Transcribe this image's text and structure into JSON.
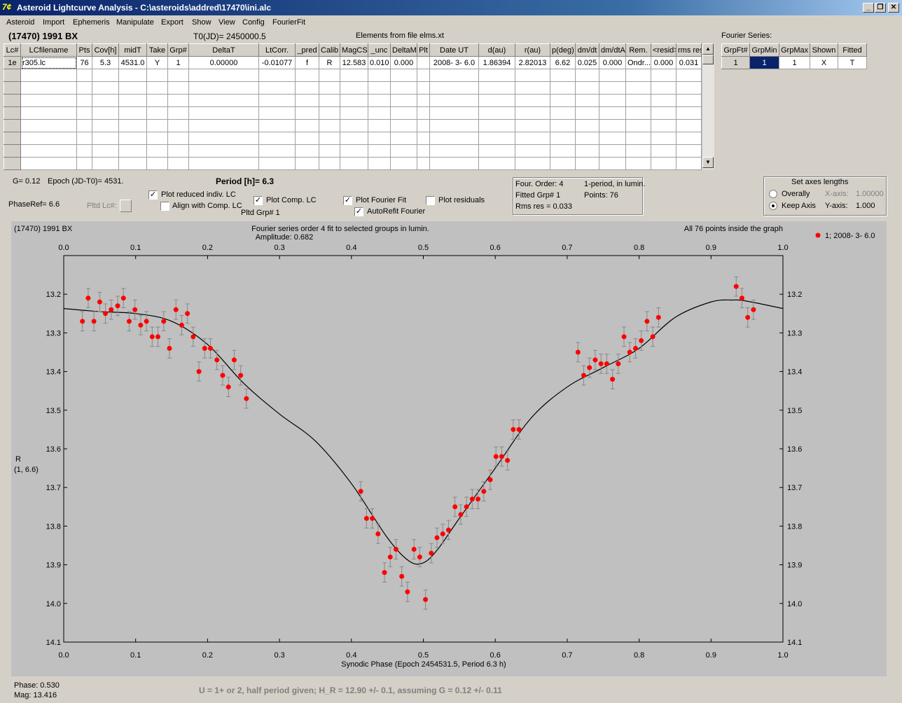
{
  "window": {
    "title": "Asteroid Lightcurve Analysis - C:\\asteroids\\addred\\17470\\ini.alc",
    "icon_name": "app-logo-icon",
    "minimize_label": "_",
    "restore_label": "❐",
    "close_label": "✕"
  },
  "menu": [
    "Asteroid",
    "Import",
    "Ephemeris",
    "Manipulate",
    "Export",
    "Show",
    "View",
    "Config",
    "FourierFit"
  ],
  "header": {
    "asteroid": "(17470) 1991 BX",
    "t0": "T0(JD)= 2450000.5",
    "elements": "Elements from file elms.xt",
    "fourier_series_label": "Fourier Series:"
  },
  "lc_table": {
    "columns": [
      "Lc#",
      "LCfilename",
      "Pts",
      "Cov[h]",
      "midT",
      "Take",
      "Grp#",
      "DeltaT",
      "LtCorr.",
      "_pred",
      "Calib",
      "MagCS",
      "_unc",
      "DeltaM",
      "Plt",
      "Date UT",
      "d(au)",
      "r(au)",
      "p(deg)",
      "dm/dt",
      "dm/dtA",
      "Rem.",
      "<resid>",
      "rms res"
    ],
    "rows": [
      [
        "1e",
        "r305.lc",
        "76",
        "5.3",
        "4531.0",
        "Y",
        "1",
        "0.00000",
        "-0.01077",
        "f",
        "R",
        "12.583",
        "0.010",
        "0.000",
        "",
        "2008- 3- 6.0",
        "1.86394",
        "2.82013",
        "6.62",
        "0.025",
        "0.000",
        "Ondr...",
        "0.000",
        "0.031"
      ]
    ]
  },
  "fourier_table": {
    "columns": [
      "GrpFt#",
      "GrpMin",
      "GrpMax",
      "Shown",
      "Fitted"
    ],
    "rows": [
      [
        "1",
        "1",
        "1",
        "X",
        "T"
      ]
    ]
  },
  "controls": {
    "g_value": "G= 0.12",
    "epoch": "Epoch (JD-T0)= 4531.",
    "period": "Period [h]= 6.3",
    "phaseref": "PhaseRef= 6.6",
    "pltd_lc": "Pltd Lc#:",
    "plot_reduced": "Plot reduced indiv. LC",
    "align_comp": "Align with Comp. LC",
    "plot_comp": "Plot Comp. LC",
    "pltd_grp": "Pltd Grp#  1",
    "plot_fourier": "Plot Fourier Fit",
    "autorefit": "AutoRefit Fourier",
    "plot_residuals": "Plot residuals",
    "checks": {
      "plot_reduced": true,
      "align_comp": false,
      "plot_comp": true,
      "plot_fourier": true,
      "autorefit": true,
      "plot_residuals": false
    }
  },
  "fit_info": {
    "order": "Four. Order:  4",
    "mode": "1-period, in lumin.",
    "fitted_grp": "Fitted Grp# 1",
    "points": "Points: 76",
    "rms": "Rms res     = 0.033"
  },
  "axes_box": {
    "title": "Set axes lengths",
    "overally": "Overally",
    "keep_axis": "Keep Axis",
    "xaxis_label": "X-axis:",
    "xaxis_value": "1.00000",
    "yaxis_label": "Y-axis:",
    "yaxis_value": "1.000",
    "selected": "Keep Axis"
  },
  "footer": {
    "phase": "Phase:  0.530",
    "mag": "Mag:   13.416",
    "note": "U = 1+ or 2, half period given; H_R = 12.90 +/- 0.1, assuming G = 0.12 +/- 0.11"
  },
  "chart_data": {
    "type": "scatter",
    "title_left": "(17470) 1991 BX",
    "title": "Fourier series order 4 fit to selected groups in lumin.",
    "subtitle": "Amplitude: 0.682",
    "title_right": "All 76 points inside the graph",
    "xlabel": "Synodic Phase (Epoch 2454531.5, Period 6.3 h)",
    "ylabel": "R",
    "ylabel2": "(1, 6.6)",
    "legend": "1; 2008- 3- 6.0",
    "legend_position": "top-right",
    "xlim": [
      0.0,
      1.0
    ],
    "ylim": [
      14.1,
      13.1
    ],
    "xticks": [
      "0.0",
      "0.1",
      "0.2",
      "0.3",
      "0.4",
      "0.5",
      "0.6",
      "0.7",
      "0.8",
      "0.9",
      "1.0"
    ],
    "yticks": [
      "13.2",
      "13.3",
      "13.4",
      "13.5",
      "13.6",
      "13.7",
      "13.8",
      "13.9",
      "14.0",
      "14.1"
    ],
    "point_color": "#ff0000",
    "points": [
      [
        0.026,
        13.27
      ],
      [
        0.034,
        13.21
      ],
      [
        0.042,
        13.27
      ],
      [
        0.05,
        13.22
      ],
      [
        0.058,
        13.25
      ],
      [
        0.066,
        13.24
      ],
      [
        0.075,
        13.23
      ],
      [
        0.083,
        13.21
      ],
      [
        0.091,
        13.27
      ],
      [
        0.099,
        13.24
      ],
      [
        0.107,
        13.28
      ],
      [
        0.115,
        13.27
      ],
      [
        0.123,
        13.31
      ],
      [
        0.131,
        13.31
      ],
      [
        0.139,
        13.27
      ],
      [
        0.147,
        13.34
      ],
      [
        0.156,
        13.24
      ],
      [
        0.164,
        13.28
      ],
      [
        0.172,
        13.25
      ],
      [
        0.18,
        13.31
      ],
      [
        0.188,
        13.4
      ],
      [
        0.196,
        13.34
      ],
      [
        0.204,
        13.34
      ],
      [
        0.213,
        13.37
      ],
      [
        0.221,
        13.41
      ],
      [
        0.229,
        13.44
      ],
      [
        0.237,
        13.37
      ],
      [
        0.246,
        13.41
      ],
      [
        0.254,
        13.47
      ],
      [
        0.413,
        13.71
      ],
      [
        0.421,
        13.78
      ],
      [
        0.429,
        13.78
      ],
      [
        0.437,
        13.82
      ],
      [
        0.446,
        13.92
      ],
      [
        0.454,
        13.88
      ],
      [
        0.462,
        13.86
      ],
      [
        0.47,
        13.93
      ],
      [
        0.478,
        13.97
      ],
      [
        0.487,
        13.86
      ],
      [
        0.495,
        13.88
      ],
      [
        0.503,
        13.99
      ],
      [
        0.511,
        13.87
      ],
      [
        0.519,
        13.83
      ],
      [
        0.527,
        13.82
      ],
      [
        0.535,
        13.81
      ],
      [
        0.544,
        13.75
      ],
      [
        0.552,
        13.77
      ],
      [
        0.56,
        13.75
      ],
      [
        0.568,
        13.73
      ],
      [
        0.576,
        13.73
      ],
      [
        0.584,
        13.71
      ],
      [
        0.593,
        13.68
      ],
      [
        0.601,
        13.62
      ],
      [
        0.609,
        13.62
      ],
      [
        0.617,
        13.63
      ],
      [
        0.625,
        13.55
      ],
      [
        0.633,
        13.55
      ],
      [
        0.715,
        13.35
      ],
      [
        0.723,
        13.41
      ],
      [
        0.731,
        13.39
      ],
      [
        0.739,
        13.37
      ],
      [
        0.747,
        13.38
      ],
      [
        0.755,
        13.38
      ],
      [
        0.763,
        13.42
      ],
      [
        0.771,
        13.38
      ],
      [
        0.779,
        13.31
      ],
      [
        0.787,
        13.35
      ],
      [
        0.795,
        13.34
      ],
      [
        0.803,
        13.32
      ],
      [
        0.811,
        13.27
      ],
      [
        0.819,
        13.31
      ],
      [
        0.827,
        13.26
      ],
      [
        0.935,
        13.18
      ],
      [
        0.943,
        13.21
      ],
      [
        0.951,
        13.26
      ],
      [
        0.959,
        13.24
      ]
    ],
    "fit_curve": [
      [
        0.0,
        13.237
      ],
      [
        0.05,
        13.245
      ],
      [
        0.1,
        13.25
      ],
      [
        0.15,
        13.27
      ],
      [
        0.2,
        13.33
      ],
      [
        0.25,
        13.43
      ],
      [
        0.3,
        13.51
      ],
      [
        0.35,
        13.58
      ],
      [
        0.4,
        13.69
      ],
      [
        0.45,
        13.83
      ],
      [
        0.48,
        13.89
      ],
      [
        0.5,
        13.895
      ],
      [
        0.52,
        13.86
      ],
      [
        0.55,
        13.78
      ],
      [
        0.6,
        13.65
      ],
      [
        0.65,
        13.52
      ],
      [
        0.7,
        13.44
      ],
      [
        0.75,
        13.39
      ],
      [
        0.8,
        13.34
      ],
      [
        0.85,
        13.26
      ],
      [
        0.9,
        13.22
      ],
      [
        0.93,
        13.215
      ],
      [
        0.95,
        13.218
      ],
      [
        1.0,
        13.237
      ]
    ]
  }
}
